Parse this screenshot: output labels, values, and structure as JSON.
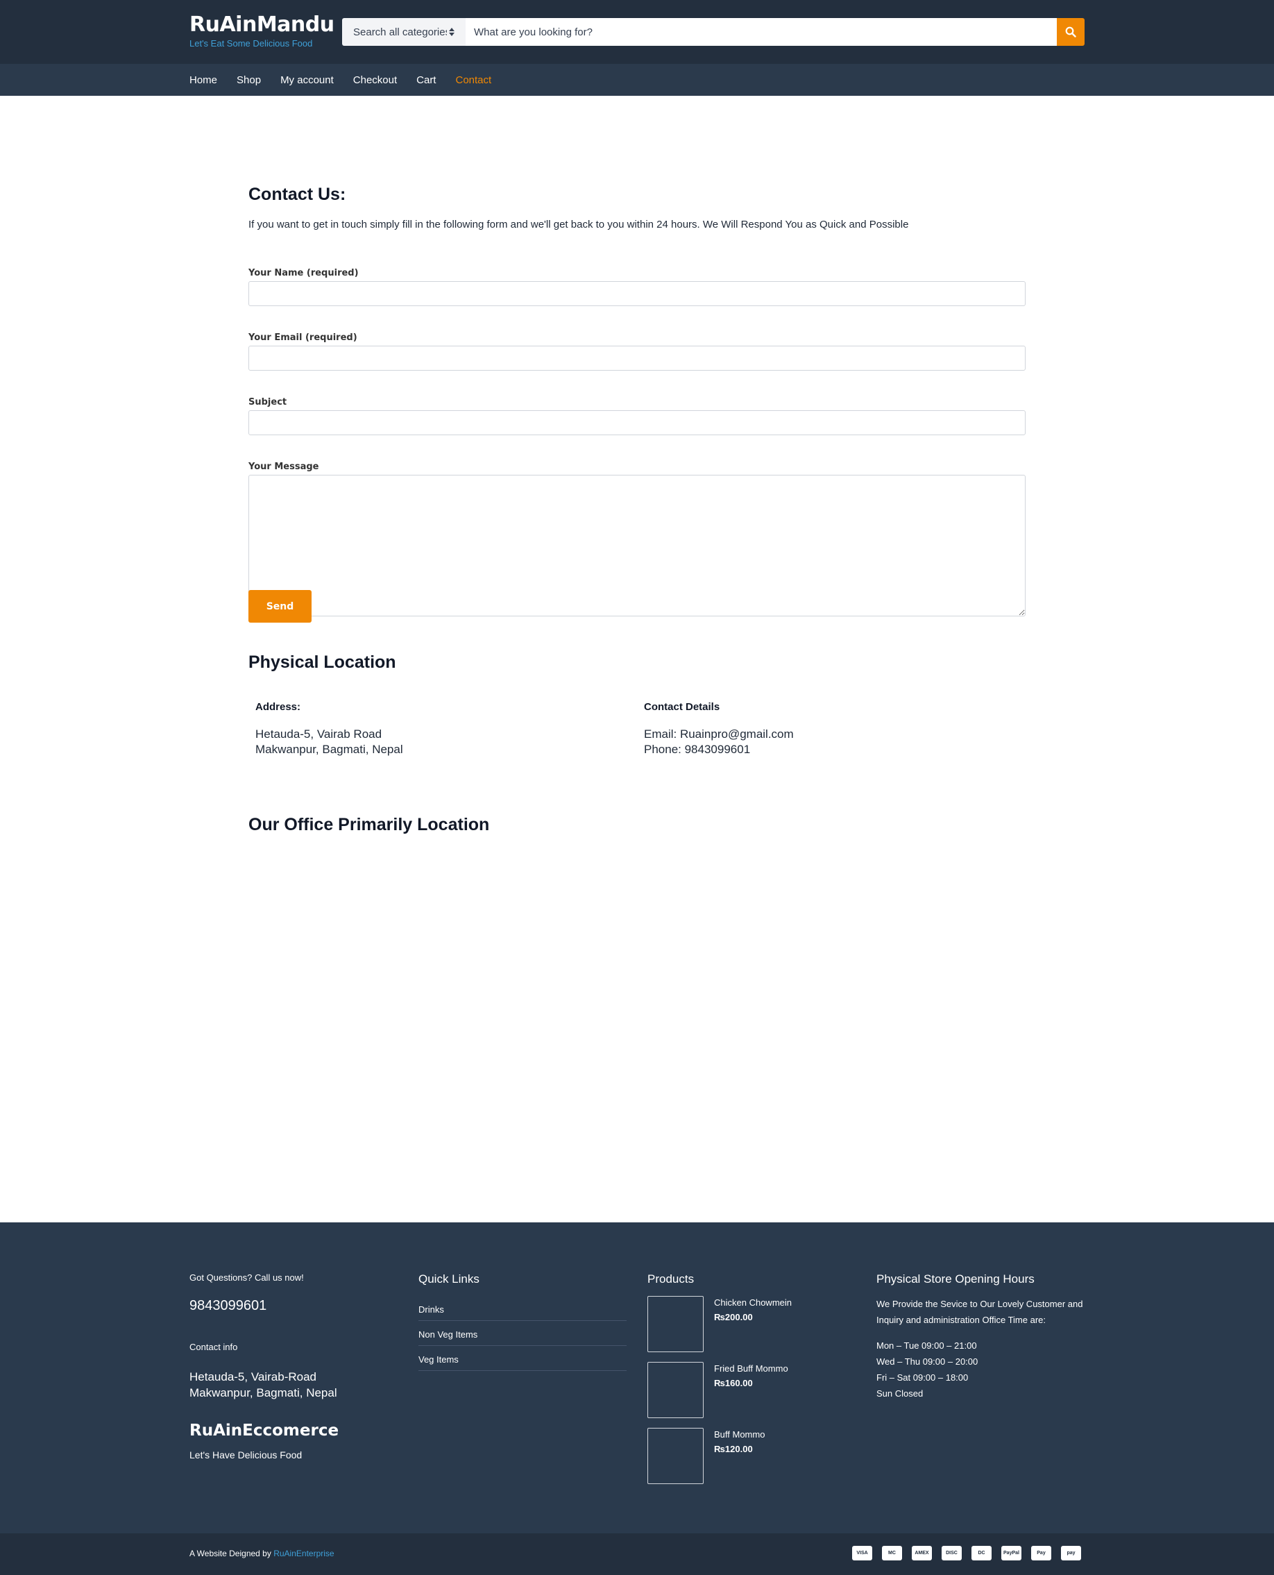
{
  "header": {
    "brand_title": "RuAinMandu",
    "brand_tagline": "Let's Eat Some Delicious Food",
    "search_category": "Search all categories",
    "search_placeholder": "What are you looking for?",
    "search_icon": "search-icon",
    "accent_color": "#f08804",
    "bg_color": "#232f3e"
  },
  "nav": {
    "items": [
      "Home",
      "Shop",
      "My account",
      "Checkout",
      "Cart",
      "Contact"
    ],
    "active": "Contact"
  },
  "contact": {
    "heading": "Contact Us:",
    "intro": "If you want to get in touch simply fill in the following form and we'll get back to you within 24 hours. We Will Respond You as Quick and Possible",
    "name_label": "Your Name (required)",
    "email_label": "Your Email (required)",
    "subject_label": "Subject",
    "message_label": "Your Message",
    "name_value": "",
    "email_value": "",
    "subject_value": "",
    "message_value": "",
    "send_label": "Send"
  },
  "location": {
    "heading": "Physical Location",
    "address_heading": "Address:",
    "address_line1": "Hetauda-5, Vairab Road",
    "address_line2": "Makwanpur, Bagmati, Nepal",
    "contact_heading": "Contact Details",
    "email_line": "Email: Ruainpro@gmail.com",
    "phone_line": "Phone: 9843099601",
    "office_heading": "Our Office Primarily Location"
  },
  "footer": {
    "questions": "Got Questions? Call us now!",
    "phone": "9843099601",
    "contact_info": "Contact info",
    "addr_line1": "Hetauda-5, Vairab-Road",
    "addr_line2": "Makwanpur, Bagmati, Nepal",
    "brand": "RuAinEccomerce",
    "brand_tag": "Let's Have Delicious Food",
    "quick_links_heading": "Quick Links",
    "quick_links": [
      "Drinks",
      "Non Veg Items",
      "Veg Items"
    ],
    "products_heading": "Products",
    "products": [
      {
        "name": "Chicken Chowmein",
        "price": "₨200.00"
      },
      {
        "name": "Fried Buff Mommo",
        "price": "₨160.00"
      },
      {
        "name": "Buff Mommo",
        "price": "₨120.00"
      }
    ],
    "hours_heading": "Physical Store Opening Hours",
    "hours_intro": "We Provide the Sevice to Our Lovely Customer and Inquiry and administration Office Time are:",
    "hours": [
      "Mon – Tue 09:00 – 21:00",
      "Wed – Thu 09:00 – 20:00",
      "Fri – Sat 09:00 – 18:00",
      "Sun Closed"
    ],
    "bg_color": "#2a3a4d"
  },
  "bottom": {
    "credit_prefix": "A Website Deigned by",
    "credit_link": "RuAinEnterprise",
    "payment_icons": [
      "visa-icon",
      "mastercard-icon",
      "amex-icon",
      "discover-icon",
      "diners-icon",
      "paypal-icon",
      "apple-pay-icon",
      "amazon-pay-icon"
    ],
    "payment_labels": [
      "VISA",
      "MC",
      "AMEX",
      "DISC",
      "DC",
      "PayPal",
      "Pay",
      "pay"
    ]
  }
}
